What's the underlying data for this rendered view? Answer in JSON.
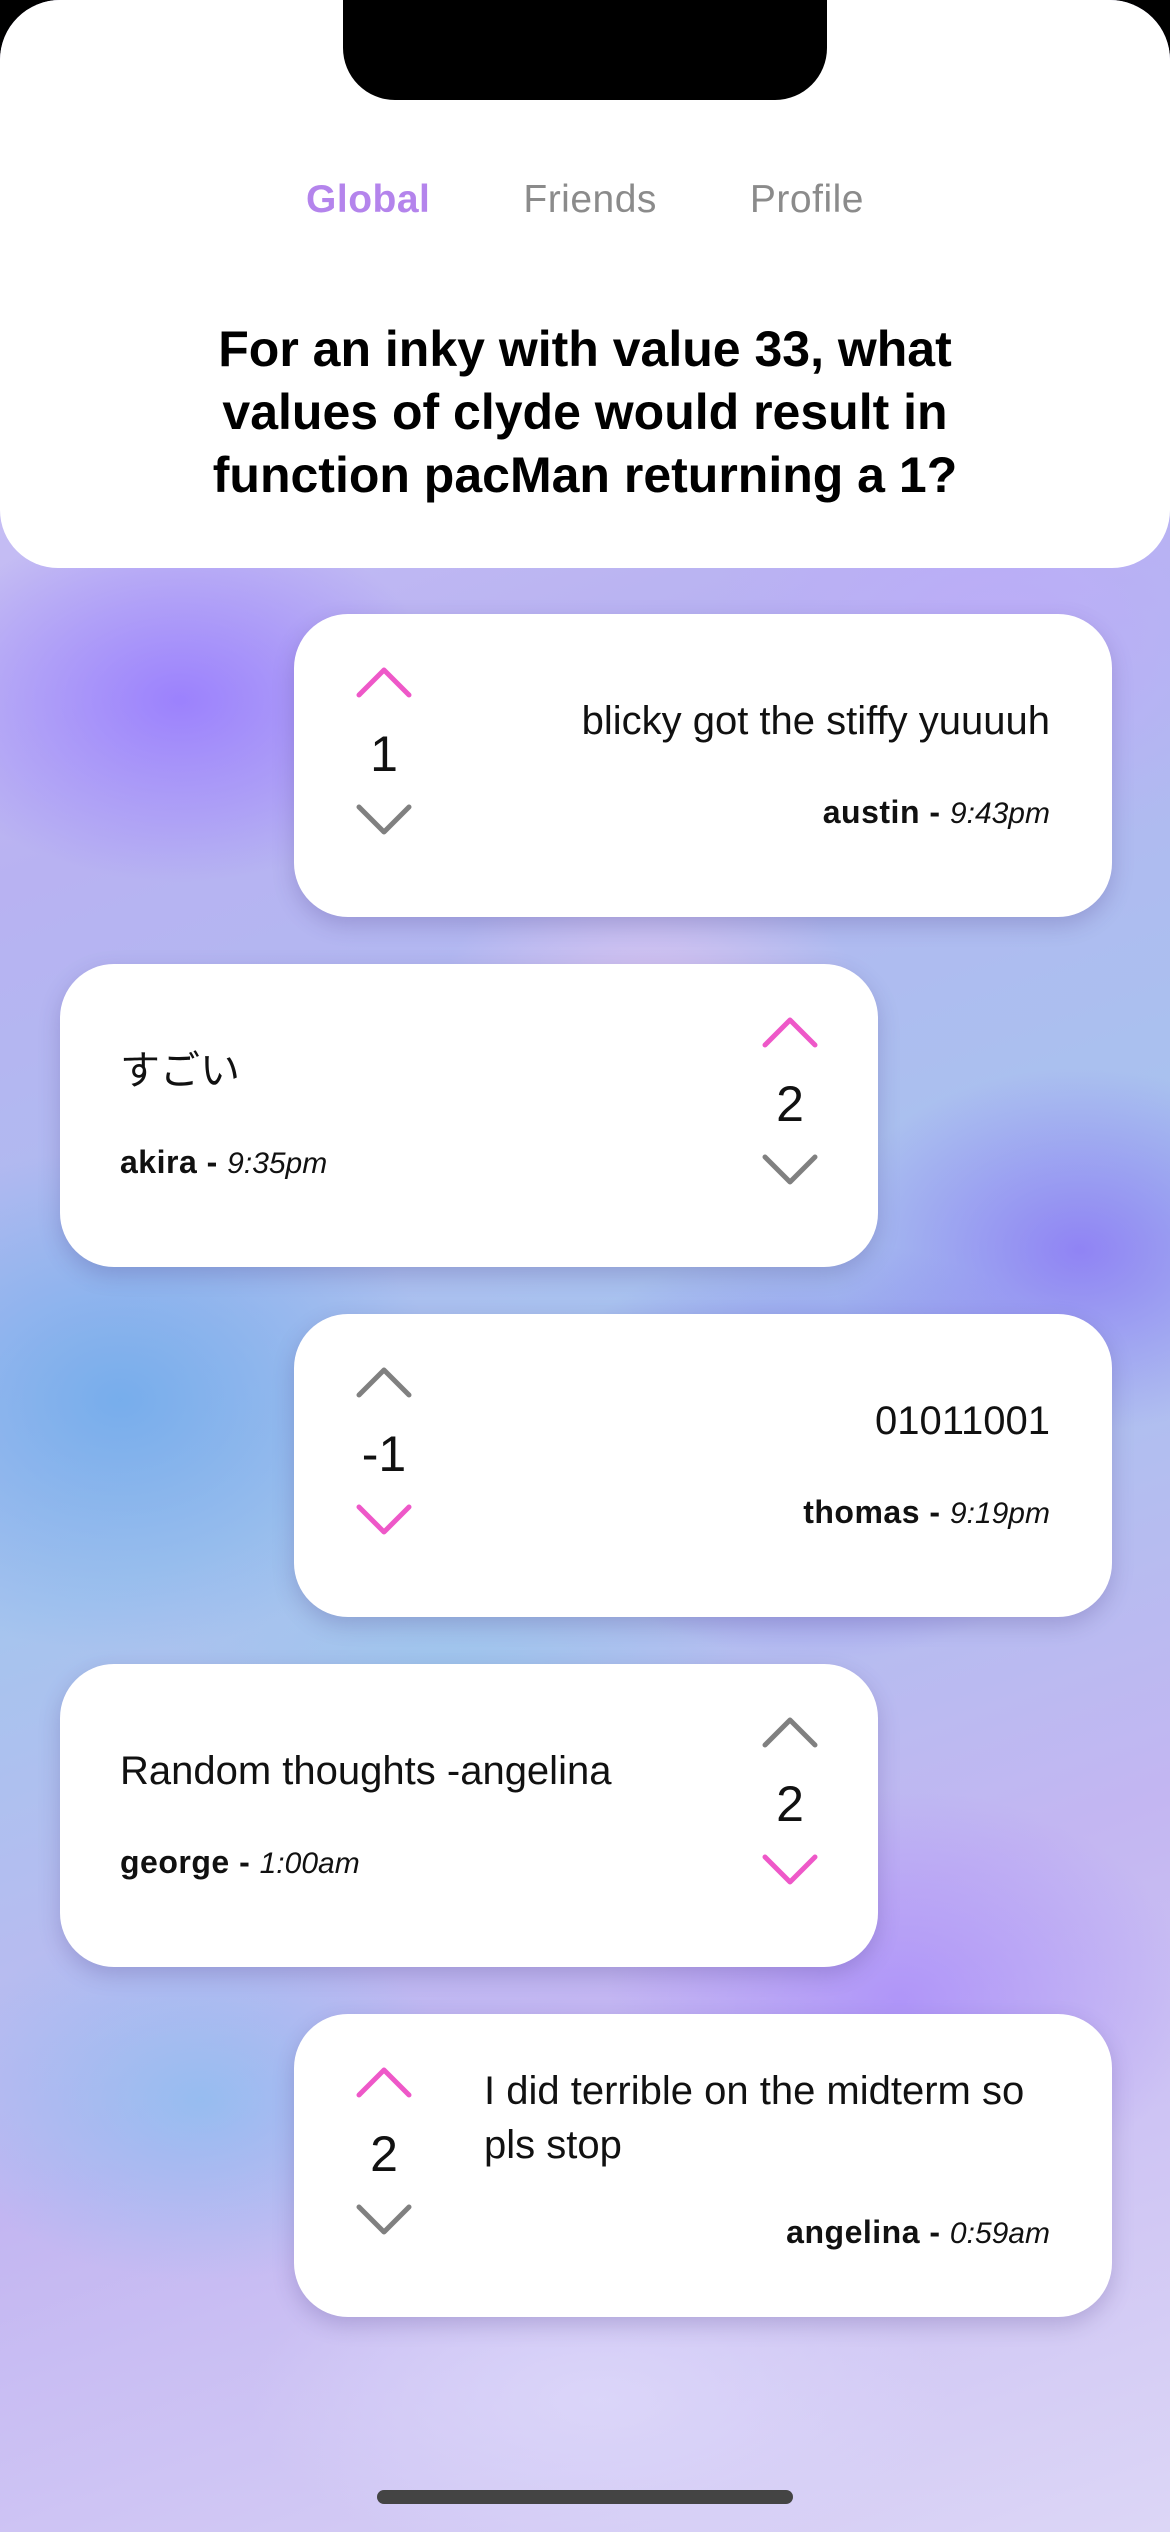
{
  "tabs": [
    {
      "label": "Global",
      "active": true
    },
    {
      "label": "Friends",
      "active": false
    },
    {
      "label": "Profile",
      "active": false
    }
  ],
  "question": "For an inky with value 33, what values of clyde would result in function pacMan returning a 1?",
  "colors": {
    "active_tab": "#b484ec",
    "vote_active": "#ee58c8",
    "vote_inactive": "#808080"
  },
  "posts": [
    {
      "message": "blicky got the stiffy yuuuuh",
      "author": "austin",
      "time": "9:43pm",
      "score": "1",
      "vote": "up"
    },
    {
      "message": "すごい",
      "author": "akira",
      "time": "9:35pm",
      "score": "2",
      "vote": "up"
    },
    {
      "message": "01011001",
      "author": "thomas",
      "time": "9:19pm",
      "score": "-1",
      "vote": "down"
    },
    {
      "message": "Random thoughts -angelina",
      "author": "george",
      "time": "1:00am",
      "score": "2",
      "vote": "down"
    },
    {
      "message": "I did terrible on the midterm so pls stop",
      "author": "angelina",
      "time": "0:59am",
      "score": "2",
      "vote": "up"
    }
  ]
}
